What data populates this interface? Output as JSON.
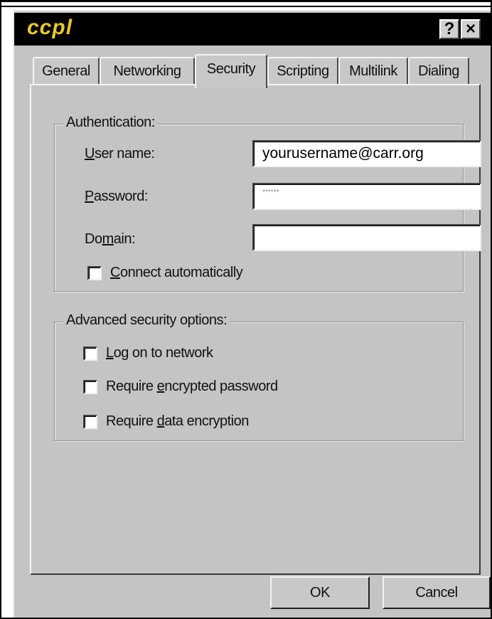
{
  "window": {
    "title": "ccpl",
    "help_label": "?",
    "close_label": "×"
  },
  "tabs": [
    {
      "label": "General",
      "active": false
    },
    {
      "label": "Networking",
      "active": false
    },
    {
      "label": "Security",
      "active": true
    },
    {
      "label": "Scripting",
      "active": false
    },
    {
      "label": "Multilink",
      "active": false
    },
    {
      "label": "Dialing",
      "active": false
    }
  ],
  "authentication": {
    "legend": "Authentication:",
    "user_name": {
      "label_first": "U",
      "label_rest": "ser name:",
      "value": "yourusername@carr.org"
    },
    "password": {
      "label_first": "P",
      "label_rest": "assword:",
      "value": "******"
    },
    "domain": {
      "label_before": "Do",
      "label_key": "m",
      "label_after": "ain:",
      "value": ""
    },
    "connect_automatically": {
      "label_first": "C",
      "label_rest": "onnect automatically",
      "checked": false
    }
  },
  "advanced": {
    "legend": "Advanced security options:",
    "log_on": {
      "label_first": "L",
      "label_rest": "og on to network",
      "checked": false
    },
    "encrypted_password": {
      "label_before": "Require ",
      "label_key": "e",
      "label_after": "ncrypted password",
      "checked": false
    },
    "data_encryption": {
      "label_before": "Require ",
      "label_key": "d",
      "label_after": "ata encryption",
      "checked": false
    }
  },
  "buttons": {
    "ok": "OK",
    "cancel": "Cancel"
  }
}
